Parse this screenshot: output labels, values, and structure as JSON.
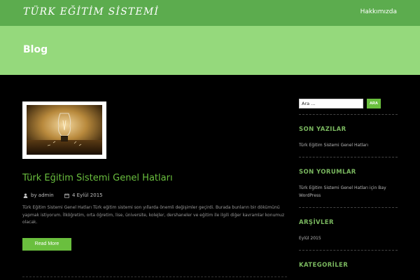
{
  "header": {
    "logo_text": "TÜRK EĞİTİM SİSTEMİ",
    "nav": [
      {
        "label": "Hakkımızda"
      }
    ],
    "accent_color": "#5cac4e"
  },
  "banner": {
    "title": "Blog",
    "color": "#95d97c"
  },
  "post": {
    "title": "Türk Eğitim Sistemi Genel Hatları",
    "author": "by admin",
    "date": "4 Eylül 2015",
    "excerpt": "Türk Eğitim Sistemi Genel Hatları Türk eğitim sistemi son yıllarda önemli değişimler geçirdi. Burada bunların bir dökümünü yapmak istiyorum. İlköğretim, orta öğretim, lise, üniversite, kolejler, dershaneler ve eğitim ile ilgili diğer kavramlar konumuz olacak.",
    "read_more_label": "Read More",
    "thumbnail_icon": "lightbulb-icon"
  },
  "sidebar": {
    "search": {
      "placeholder": "Ara ...",
      "button_label": "ARA"
    },
    "recent_posts": {
      "title": "SON YAZILAR",
      "items": [
        "Türk Eğitim Sistemi Genel Hatları"
      ]
    },
    "recent_comments": {
      "title": "SON YORUMLAR",
      "items": [
        "Türk Eğitim Sistemi Genel Hatları için Bay WordPress"
      ]
    },
    "archives": {
      "title": "ARŞİVLER",
      "items": [
        "Eylül 2015"
      ]
    },
    "categories": {
      "title": "KATEGORİLER"
    }
  },
  "colors": {
    "link_green": "#6abf3e",
    "background": "#000000"
  }
}
